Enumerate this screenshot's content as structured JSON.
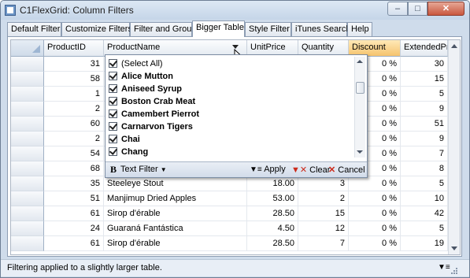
{
  "window": {
    "title": "C1FlexGrid: Column Filters",
    "minimize": "–",
    "maximize": "□",
    "close": "✕"
  },
  "tabs": [
    {
      "label": "Default Filter"
    },
    {
      "label": "Customize Filters"
    },
    {
      "label": "Filter and Group"
    },
    {
      "label": "Bigger Table"
    },
    {
      "label": "Style Filter"
    },
    {
      "label": "iTunes Search"
    },
    {
      "label": "Help"
    }
  ],
  "grid": {
    "columns": [
      "ProductID",
      "ProductName",
      "UnitPrice",
      "Quantity",
      "Discount",
      "ExtendedPric"
    ],
    "rows": [
      {
        "product_id": "31",
        "product_name": "",
        "unit_price": "",
        "quantity": "",
        "discount": "0 %",
        "extended": "30"
      },
      {
        "product_id": "58",
        "product_name": "",
        "unit_price": "",
        "quantity": "",
        "discount": "0 %",
        "extended": "15"
      },
      {
        "product_id": "1",
        "product_name": "",
        "unit_price": "",
        "quantity": "",
        "discount": "0 %",
        "extended": "5"
      },
      {
        "product_id": "2",
        "product_name": "",
        "unit_price": "",
        "quantity": "",
        "discount": "0 %",
        "extended": "9"
      },
      {
        "product_id": "60",
        "product_name": "",
        "unit_price": "",
        "quantity": "",
        "discount": "0 %",
        "extended": "51"
      },
      {
        "product_id": "2",
        "product_name": "",
        "unit_price": "",
        "quantity": "",
        "discount": "0 %",
        "extended": "9"
      },
      {
        "product_id": "54",
        "product_name": "",
        "unit_price": "",
        "quantity": "",
        "discount": "0 %",
        "extended": "7"
      },
      {
        "product_id": "68",
        "product_name": "",
        "unit_price": "",
        "quantity": "",
        "discount": "0 %",
        "extended": "8"
      },
      {
        "product_id": "35",
        "product_name": "Steeleye Stout",
        "unit_price": "18.00",
        "quantity": "3",
        "discount": "0 %",
        "extended": "5"
      },
      {
        "product_id": "51",
        "product_name": "Manjimup Dried Apples",
        "unit_price": "53.00",
        "quantity": "2",
        "discount": "0 %",
        "extended": "10"
      },
      {
        "product_id": "61",
        "product_name": "Sirop d'érable",
        "unit_price": "28.50",
        "quantity": "15",
        "discount": "0 %",
        "extended": "42"
      },
      {
        "product_id": "24",
        "product_name": "Guaraná Fantástica",
        "unit_price": "4.50",
        "quantity": "12",
        "discount": "0 %",
        "extended": "5"
      },
      {
        "product_id": "61",
        "product_name": "Sirop d'érable",
        "unit_price": "28.50",
        "quantity": "7",
        "discount": "0 %",
        "extended": "19"
      }
    ]
  },
  "filter_popup": {
    "items": [
      {
        "label": "(Select All)",
        "checked": true,
        "bold": false
      },
      {
        "label": "Alice Mutton",
        "checked": true,
        "bold": true
      },
      {
        "label": "Aniseed Syrup",
        "checked": true,
        "bold": true
      },
      {
        "label": "Boston Crab Meat",
        "checked": true,
        "bold": true
      },
      {
        "label": "Camembert Pierrot",
        "checked": true,
        "bold": true
      },
      {
        "label": "Carnarvon Tigers",
        "checked": true,
        "bold": true
      },
      {
        "label": "Chai",
        "checked": true,
        "bold": true
      },
      {
        "label": "Chang",
        "checked": true,
        "bold": true
      }
    ],
    "text_filter_label": "Text Filter",
    "apply_label": "Apply",
    "clear_label": "Clear",
    "cancel_label": "Cancel"
  },
  "status": {
    "text": "Filtering applied to a slightly larger table."
  },
  "colors": {
    "window_bg": "#cfdceb",
    "selected_header": "#f5c36e",
    "cancel_icon": "#cc2a1a",
    "clear_icon": "#cc2a1a"
  }
}
